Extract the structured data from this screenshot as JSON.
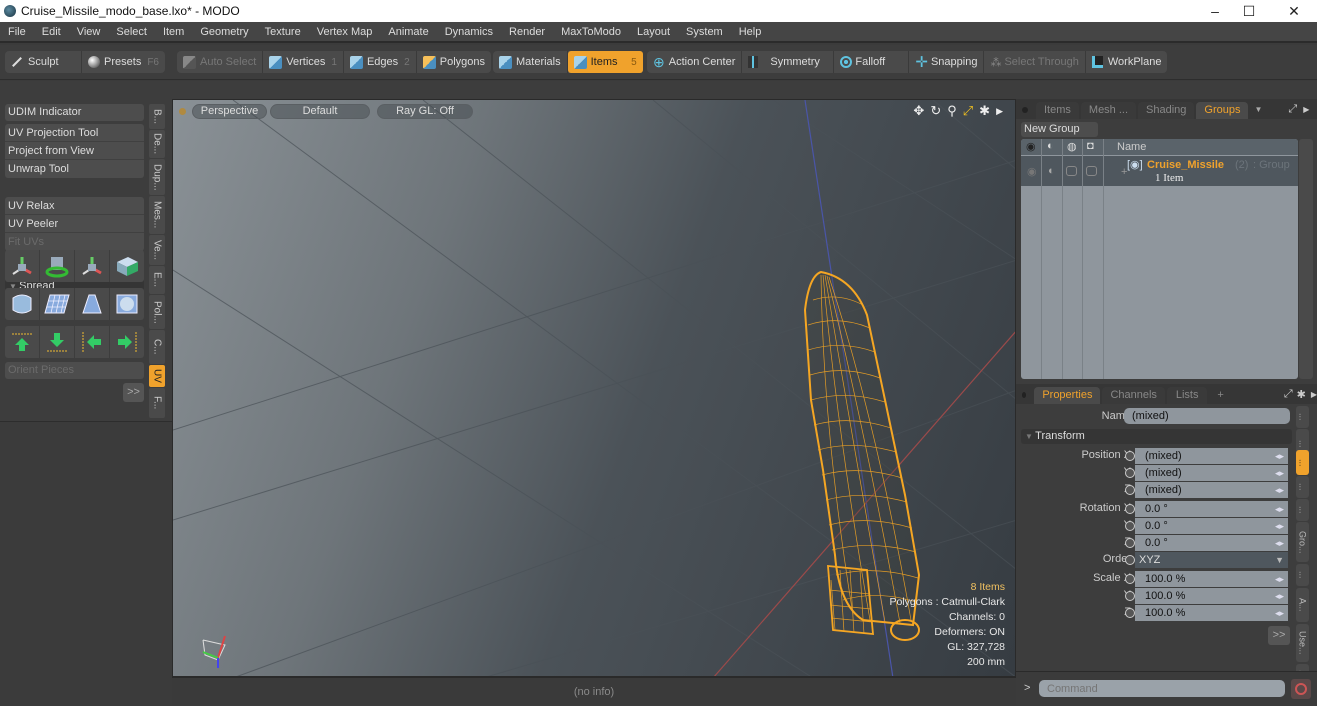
{
  "window": {
    "title": "Cruise_Missile_modo_base.lxo* - MODO",
    "minimize": "–",
    "maximize": "☐",
    "close": "✕"
  },
  "menu": [
    "File",
    "Edit",
    "View",
    "Select",
    "Item",
    "Geometry",
    "Texture",
    "Vertex Map",
    "Animate",
    "Dynamics",
    "Render",
    "MaxToModo",
    "Layout",
    "System",
    "Help"
  ],
  "toolbar": {
    "sculpt": "Sculpt",
    "presets": "Presets",
    "presets_key": "F6",
    "auto_select": "Auto Select",
    "vertices": "Vertices",
    "vertices_key": "1",
    "edges": "Edges",
    "edges_key": "2",
    "polygons": "Polygons",
    "materials": "Materials",
    "items": "Items",
    "items_key": "5",
    "action_center": "Action Center",
    "symmetry": "Symmetry",
    "falloff": "Falloff",
    "snapping": "Snapping",
    "select_through": "Select Through",
    "workplane": "WorkPlane"
  },
  "left_panel": {
    "udim": "UDIM Indicator",
    "group1": [
      "UV Projection Tool",
      "Project from View",
      "Unwrap Tool"
    ],
    "spread": "Spread",
    "group2": [
      "UV Relax",
      "UV Peeler"
    ],
    "fit_uvs": "Fit UVs",
    "orient": "Orient Pieces",
    "more": ">>",
    "vtabs": [
      "B...",
      "De...",
      "Dup...",
      "Mes...",
      "Ve...",
      "E...",
      "Pol...",
      "C...",
      "UV",
      "F..."
    ],
    "active_vtab": "UV"
  },
  "viewport": {
    "view": "Perspective",
    "shading": "Default",
    "raygl": "Ray GL: Off",
    "hud": {
      "items": "8 Items",
      "polygons": "Polygons : Catmull-Clark",
      "channels": "Channels: 0",
      "deformers": "Deformers: ON",
      "gl": "GL: 327,728",
      "scale": "200 mm"
    },
    "status": "(no info)"
  },
  "groups_panel": {
    "tabs": [
      "Items",
      "Mesh ...",
      "Shading",
      "Groups"
    ],
    "active_tab": "Groups",
    "new_group": "New Group",
    "col_name": "Name",
    "row": {
      "name": "Cruise_Missile",
      "count": "(2)",
      "type": ": Group",
      "sub": "1 Item"
    }
  },
  "properties": {
    "tabs": [
      "Properties",
      "Channels",
      "Lists",
      "+"
    ],
    "active_tab": "Properties",
    "name_label": "Name",
    "name_value": "(mixed)",
    "transform_label": "Transform",
    "rows": [
      {
        "label": "Position X",
        "value": "(mixed)"
      },
      {
        "label": "Y",
        "value": "(mixed)"
      },
      {
        "label": "Z",
        "value": "(mixed)"
      },
      {
        "label": "Rotation X",
        "value": "0.0 °"
      },
      {
        "label": "Y",
        "value": "0.0 °"
      },
      {
        "label": "Z",
        "value": "0.0 °"
      },
      {
        "label": "Order",
        "value": "XYZ"
      },
      {
        "label": "Scale X",
        "value": "100.0 %"
      },
      {
        "label": "Y",
        "value": "100.0 %"
      },
      {
        "label": "Z",
        "value": "100.0 %"
      }
    ],
    "more": ">>",
    "side_tabs": [
      "...",
      "...",
      "...",
      "...",
      "...",
      "Gro...",
      "...",
      "A...",
      "Use...",
      "..."
    ]
  },
  "command": {
    "prompt": ">",
    "placeholder": "Command"
  },
  "colors": {
    "accent": "#f0a22c",
    "wireframe": "#f5a623"
  }
}
